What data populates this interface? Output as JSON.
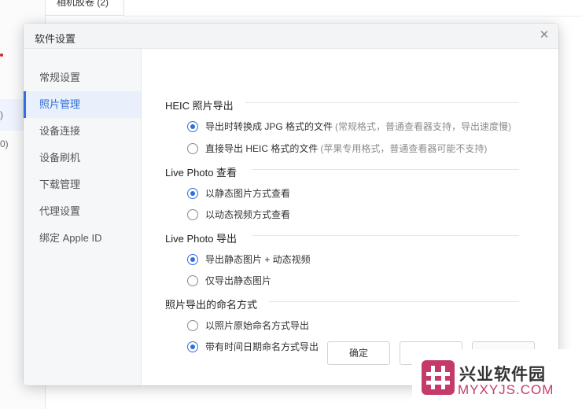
{
  "background": {
    "tab_label": "相机胶卷 (2)",
    "side_text_1": ")",
    "side_text_2": "0)"
  },
  "dialog": {
    "title": "软件设置",
    "close_icon": "close-icon"
  },
  "nav": {
    "items": [
      {
        "label": "常规设置"
      },
      {
        "label": "照片管理"
      },
      {
        "label": "设备连接"
      },
      {
        "label": "设备刷机"
      },
      {
        "label": "下载管理"
      },
      {
        "label": "代理设置"
      },
      {
        "label": "绑定 Apple ID"
      }
    ],
    "active_index": 1
  },
  "sections": [
    {
      "title": "HEIC 照片导出",
      "options": [
        {
          "label": "导出时转换成 JPG 格式的文件",
          "hint": "(常规格式，普通查看器支持，导出速度慢)",
          "checked": true
        },
        {
          "label": "直接导出 HEIC 格式的文件",
          "hint": "(苹果专用格式，普通查看器可能不支持)",
          "checked": false
        }
      ]
    },
    {
      "title": "Live Photo 查看",
      "options": [
        {
          "label": "以静态图片方式查看",
          "checked": true
        },
        {
          "label": "以动态视频方式查看",
          "checked": false
        }
      ]
    },
    {
      "title": "Live Photo 导出",
      "options": [
        {
          "label": "导出静态图片 + 动态视频",
          "checked": true
        },
        {
          "label": "仅导出静态图片",
          "checked": false
        }
      ]
    },
    {
      "title": "照片导出的命名方式",
      "options": [
        {
          "label": "以照片原始命名方式导出",
          "checked": false
        },
        {
          "label": "带有时间日期命名方式导出",
          "checked": true
        }
      ]
    }
  ],
  "buttons": {
    "confirm": "确定",
    "cancel": "",
    "apply": ""
  },
  "watermark": {
    "name": "兴业软件园",
    "url": "MYXYJS.COM"
  },
  "colors": {
    "accent": "#2f6fde",
    "watermark_pink": "#c43a6b"
  }
}
